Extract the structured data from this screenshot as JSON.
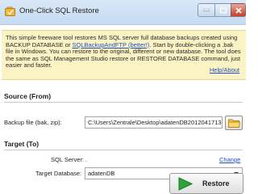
{
  "window": {
    "title": "One-Click SQL Restore"
  },
  "info": {
    "text_1": "This simple freeware tool restores MS SQL server full database backups created using BACKUP DATABASE or ",
    "link_text": "SQLBackupAndFTP (better!)",
    "text_2": ". Start by double-clicking a .bak file in Windows. You can restore to the original, different or new database. The tool does the same as SQL Management Studio restore or RESTORE DATABASE command, just easier and faster.",
    "help_link": "Help/About"
  },
  "source": {
    "title": "Source (From)",
    "backup_label": "Backup file (bak, zip):",
    "backup_value": "C:\\Users\\Zentrale\\Desktop\\adatenDB2012041713"
  },
  "target": {
    "title": "Target (To)",
    "server_label": "SQL Server:",
    "server_value": ".",
    "change_link": "Change",
    "database_label": "Target Database:",
    "database_value": "adatenDB"
  },
  "actions": {
    "restore_label": "Restore"
  },
  "colors": {
    "info_bg": "#fbf3c4",
    "link": "#1f4fc0",
    "title_bar": "#c5dbf2",
    "restore_icon": "#2fa23a"
  }
}
